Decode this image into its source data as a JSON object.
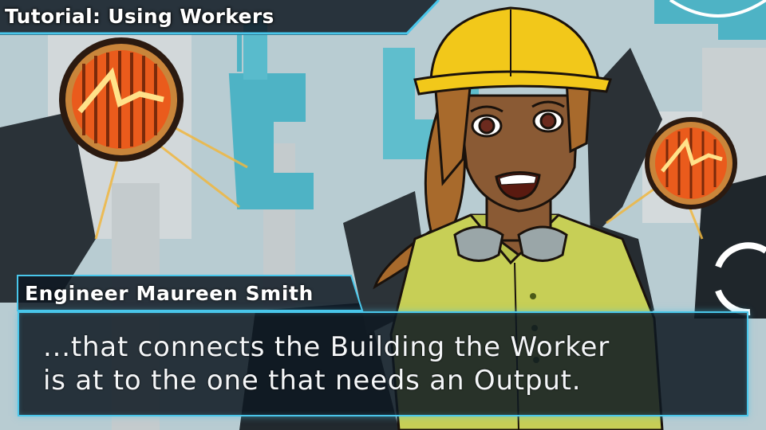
{
  "tutorial": {
    "title": "Tutorial: Using Workers"
  },
  "dialogue": {
    "speaker": "Engineer Maureen Smith",
    "lines": [
      "...that connects the Building the Worker",
      "is at to the one that needs an Output."
    ]
  },
  "colors": {
    "accent": "#49c6ea",
    "hard_hat": "#f2c81a",
    "shirt": "#c7cf56",
    "skin": "#8a5a34",
    "hair": "#a86a2c",
    "lamp_orange": "#ea5b1c",
    "backdrop": "#b8ccd2"
  },
  "icons": {
    "progress_ring": "loading-ring-icon",
    "lamps": "work-lamp-icon"
  }
}
